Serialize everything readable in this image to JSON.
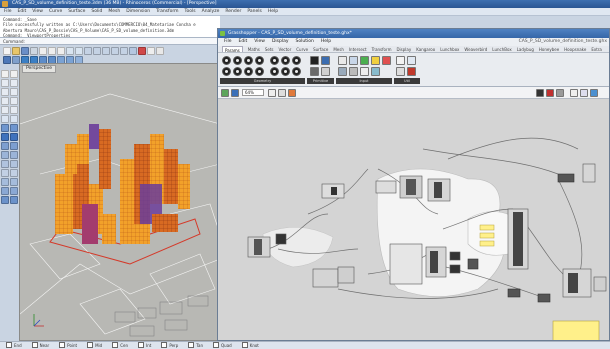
{
  "rhino": {
    "title": "CAS_P_SD_volume_definition_teste.3dm (36 MB) - Rhinoceros (Commercial) - [Perspective]",
    "menu": [
      "File",
      "Edit",
      "View",
      "Curve",
      "Surface",
      "Solid",
      "Mesh",
      "Dimension",
      "Transform",
      "Tools",
      "Analyze",
      "Render",
      "Panels",
      "Help"
    ],
    "command_history": [
      "Command: _Save",
      "File successfully written as C:\\Users\\Documents\\COMMERCIO\\04_Matetariae Concha e Abertura Mauro\\CAS_P_Dossie\\CAS_P_Volume\\CAS_P_SD_volume_definition.3dm",
      "Command: _ViewportProperties"
    ],
    "command_prompt": "Command:",
    "viewport_label": "Perspective",
    "status_items": [
      "End",
      "Near",
      "Point",
      "Mid",
      "Cen",
      "Int",
      "Perp",
      "Tan",
      "Quad",
      "Knot"
    ]
  },
  "gh": {
    "title": "Grasshopper - CAS_P_SD_volume_definition_teste.ghx*",
    "file_label": "CAS_P_SD_volume_definition_teste.ghx",
    "menu": [
      "File",
      "Edit",
      "View",
      "Display",
      "Solution",
      "Help"
    ],
    "tabs": [
      "Params",
      "Maths",
      "Sets",
      "Vector",
      "Curve",
      "Surface",
      "Mesh",
      "Intersect",
      "Transform",
      "Display",
      "Kangaroo",
      "Lunchbox",
      "Weaverbird",
      "LunchBox",
      "Ladybug",
      "Honeybee",
      "Hoopsnake",
      "Extra"
    ],
    "active_tab": "Params",
    "ribbon_groups": [
      "Geometry",
      "Primitive",
      "Input",
      "Util"
    ],
    "zoom": "64%"
  },
  "colors": {
    "massing_orange": "#f2a12a",
    "massing_red": "#c84a1f",
    "massing_purple": "#6b3d9a",
    "panel_yellow": "#fff08a",
    "gh_title": "#3566a8"
  }
}
